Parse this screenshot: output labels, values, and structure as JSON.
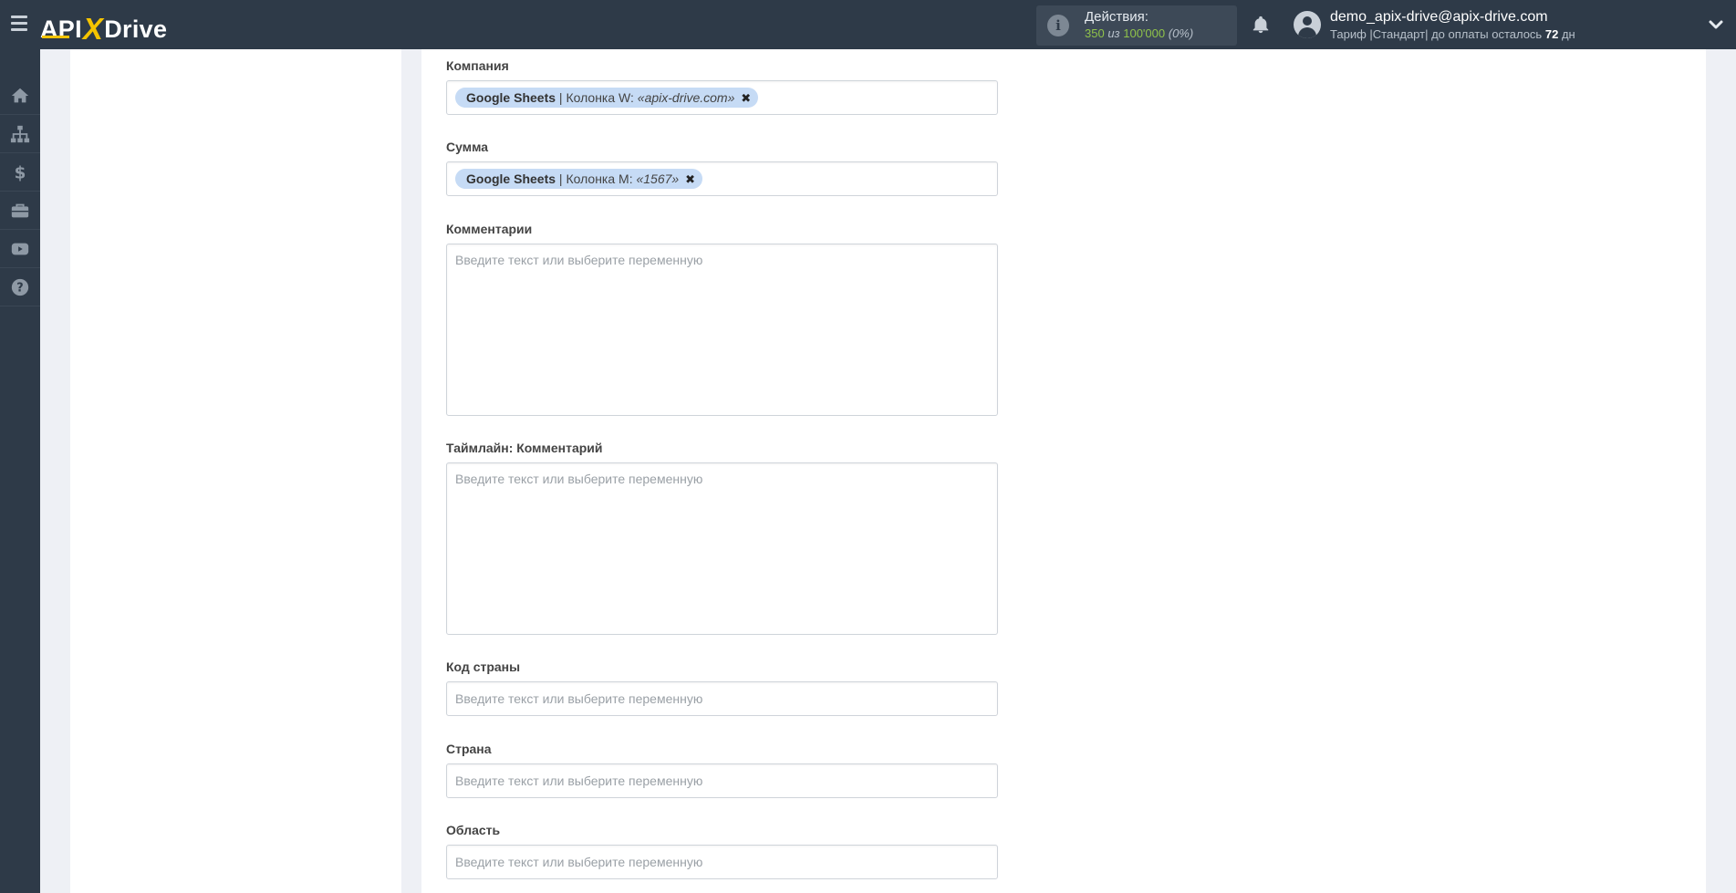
{
  "header": {
    "logo": {
      "part1": "API",
      "x": "X",
      "part2": "Drive"
    },
    "actions": {
      "label": "Действия:",
      "used": "350",
      "of_word": "из",
      "total": "100'000",
      "percent": "(0%)"
    },
    "user": {
      "email": "demo_apix-drive@apix-drive.com",
      "plan_text": "Тариф |Стандарт| до оплаты осталось",
      "days_left": "72",
      "days_unit": "дн"
    }
  },
  "sidebar": {
    "items": [
      {
        "icon": "home-icon"
      },
      {
        "icon": "sitemap-icon"
      },
      {
        "icon": "dollar-icon"
      },
      {
        "icon": "briefcase-icon"
      },
      {
        "icon": "youtube-icon"
      },
      {
        "icon": "help-icon"
      }
    ]
  },
  "form": {
    "company": {
      "label": "Компания",
      "tag": {
        "source": "Google Sheets",
        "column": " | Колонка W: ",
        "value": "«apix-drive.com»",
        "remove": "✖"
      }
    },
    "sum": {
      "label": "Сумма",
      "tag": {
        "source": "Google Sheets",
        "column": " | Колонка M: ",
        "value": "«1567»",
        "remove": "✖"
      }
    },
    "comments": {
      "label": "Комментарии",
      "placeholder": "Введите текст или выберите переменную"
    },
    "timeline_comment": {
      "label": "Таймлайн: Комментарий",
      "placeholder": "Введите текст или выберите переменную"
    },
    "country_code": {
      "label": "Код страны",
      "placeholder": "Введите текст или выберите переменную"
    },
    "country": {
      "label": "Страна",
      "placeholder": "Введите текст или выберите переменную"
    },
    "region": {
      "label": "Область",
      "placeholder": "Введите текст или выберите переменную"
    }
  },
  "colors": {
    "topbar": "#2e3a48",
    "accent_yellow": "#f5c400",
    "green": "#8fc24a",
    "tag_bg": "#c6dbf5",
    "page_bg": "#eef0f5"
  }
}
